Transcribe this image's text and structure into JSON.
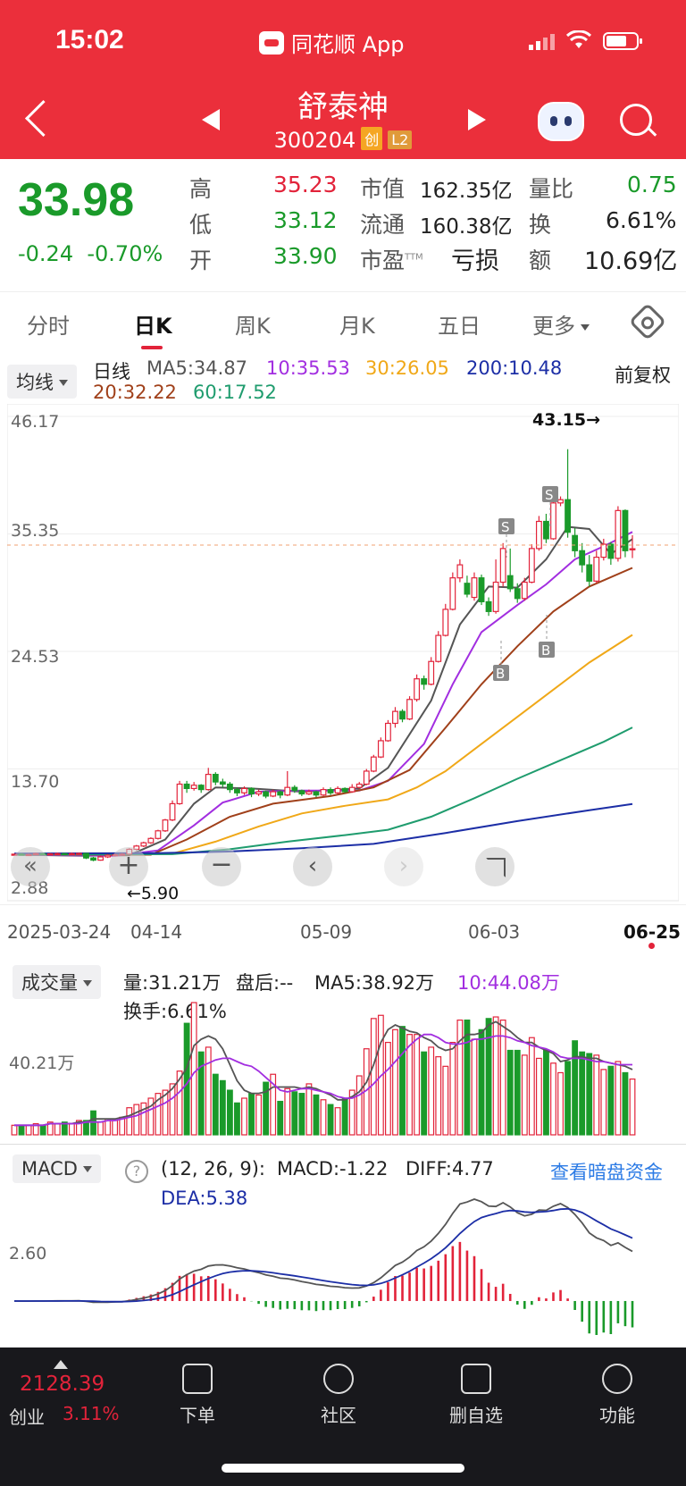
{
  "status_bar": {
    "time": "15:02",
    "app": "同花顺 App"
  },
  "header": {
    "title": "舒泰神",
    "code": "300204",
    "tag1": "创",
    "tag2": "L2"
  },
  "quote": {
    "price": "33.98",
    "change": "-0.24",
    "change_pct": "-0.70%",
    "high_label": "高",
    "high": "35.23",
    "low_label": "低",
    "low": "33.12",
    "open_label": "开",
    "open": "33.90",
    "mcap_label": "市值",
    "mcap": "162.35亿",
    "float_label": "流通",
    "float": "160.38亿",
    "pe_label": "市盈",
    "pe_sup": "TTM",
    "pe": "亏损",
    "vol_ratio_label": "量比",
    "vol_ratio": "0.75",
    "turnover_label": "换",
    "turnover": "6.61%",
    "amount_label": "额",
    "amount": "10.69亿"
  },
  "tabs": [
    "分时",
    "日K",
    "周K",
    "月K",
    "五日",
    "更多"
  ],
  "ma": {
    "selector": "均线",
    "period": "日线",
    "ma5": "MA5:34.87",
    "ma10": "10:35.53",
    "ma30": "30:26.05",
    "ma200": "200:10.48",
    "ma20": "20:32.22",
    "ma60": "60:17.52",
    "adjust": "前复权"
  },
  "kchart": {
    "y_labels": [
      "46.17",
      "35.35",
      "24.53",
      "13.70",
      "2.88"
    ],
    "max_label": "43.15→",
    "min_label": "←5.90",
    "x_labels": [
      "2025-03-24",
      "04-14",
      "05-09",
      "06-03",
      "06-25"
    ]
  },
  "volume": {
    "selector": "成交量",
    "vol": "量:31.21万",
    "after": "盘后:--",
    "ma5": "MA5:38.92万",
    "ma10": "10:44.08万",
    "turnover": "换手:6.61%",
    "y_label": "40.21万"
  },
  "macd": {
    "selector": "MACD",
    "params": "(12, 26, 9):",
    "macd": "MACD:-1.22",
    "diff": "DIFF:4.77",
    "dea": "DEA:5.38",
    "link": "查看暗盘资金",
    "y_label": "2.60"
  },
  "bottom": {
    "index_value": "2128.39",
    "index_name": "创业",
    "index_pct": "3.11%",
    "nav": [
      "下单",
      "社区",
      "删自选",
      "功能"
    ]
  },
  "colors": {
    "up": "#e2233a",
    "down": "#1a9a2a",
    "brand": "#eb2f3b"
  },
  "chart_data": {
    "type": "candlestick",
    "x_start": "2025-03-24",
    "x_end": "2025-06-25",
    "ylim": [
      2.88,
      46.17
    ],
    "candles": [
      [
        5.8,
        5.85,
        5.9,
        5.75
      ],
      [
        5.85,
        5.8,
        5.95,
        5.75
      ],
      [
        5.8,
        5.82,
        5.9,
        5.7
      ],
      [
        5.82,
        5.9,
        6.0,
        5.78
      ],
      [
        5.9,
        5.85,
        5.98,
        5.8
      ],
      [
        5.85,
        5.88,
        5.95,
        5.8
      ],
      [
        5.88,
        5.9,
        6.0,
        5.82
      ],
      [
        5.9,
        5.87,
        5.96,
        5.8
      ],
      [
        5.87,
        5.9,
        6.0,
        5.85
      ],
      [
        5.9,
        5.92,
        6.0,
        5.85
      ],
      [
        5.92,
        5.5,
        5.95,
        5.4
      ],
      [
        5.5,
        5.3,
        5.6,
        5.2
      ],
      [
        5.3,
        5.6,
        5.7,
        5.25
      ],
      [
        5.6,
        5.75,
        5.85,
        5.5
      ],
      [
        5.75,
        5.8,
        5.9,
        5.7
      ],
      [
        5.8,
        5.85,
        5.95,
        5.75
      ],
      [
        5.85,
        6.3,
        6.4,
        5.8
      ],
      [
        6.3,
        6.6,
        6.7,
        6.2
      ],
      [
        6.6,
        6.9,
        7.0,
        6.5
      ],
      [
        6.9,
        7.3,
        7.4,
        6.8
      ],
      [
        7.3,
        8.0,
        8.1,
        7.2
      ],
      [
        8.0,
        9.0,
        9.1,
        7.9
      ],
      [
        9.0,
        10.5,
        10.8,
        8.9
      ],
      [
        10.5,
        12.3,
        12.6,
        10.4
      ],
      [
        12.3,
        11.9,
        12.6,
        11.5
      ],
      [
        11.9,
        12.2,
        12.5,
        11.7
      ],
      [
        12.2,
        11.8,
        12.3,
        11.5
      ],
      [
        11.8,
        13.2,
        13.8,
        11.7
      ],
      [
        13.2,
        12.5,
        13.4,
        12.2
      ],
      [
        12.5,
        12.3,
        12.8,
        12.0
      ],
      [
        12.3,
        11.8,
        12.5,
        11.5
      ],
      [
        11.8,
        11.5,
        12.0,
        11.2
      ],
      [
        11.5,
        11.9,
        12.1,
        11.3
      ],
      [
        11.9,
        11.4,
        12.0,
        11.1
      ],
      [
        11.4,
        11.6,
        11.8,
        11.2
      ],
      [
        11.6,
        11.2,
        11.7,
        11.0
      ],
      [
        11.2,
        11.6,
        11.8,
        11.1
      ],
      [
        11.6,
        11.3,
        11.7,
        11.0
      ],
      [
        11.3,
        12.0,
        13.5,
        11.2
      ],
      [
        12.0,
        11.7,
        12.2,
        11.5
      ],
      [
        11.7,
        11.4,
        11.8,
        11.2
      ],
      [
        11.4,
        11.6,
        11.8,
        11.3
      ],
      [
        11.6,
        11.3,
        11.7,
        11.1
      ],
      [
        11.3,
        11.8,
        12.0,
        11.2
      ],
      [
        11.8,
        11.5,
        12.0,
        11.3
      ],
      [
        11.5,
        11.9,
        12.1,
        11.4
      ],
      [
        11.9,
        11.6,
        12.0,
        11.5
      ],
      [
        11.6,
        12.0,
        12.3,
        11.5
      ],
      [
        12.0,
        12.3,
        12.5,
        11.9
      ],
      [
        12.3,
        13.5,
        13.7,
        12.2
      ],
      [
        13.5,
        14.8,
        15.0,
        13.4
      ],
      [
        14.8,
        16.3,
        16.6,
        14.7
      ],
      [
        16.3,
        17.9,
        18.2,
        16.2
      ],
      [
        17.9,
        19.0,
        19.4,
        17.5
      ],
      [
        19.0,
        18.3,
        19.2,
        18.0
      ],
      [
        18.3,
        20.1,
        20.4,
        18.2
      ],
      [
        20.1,
        22.0,
        22.4,
        19.9
      ],
      [
        22.0,
        21.5,
        22.3,
        21.0
      ],
      [
        21.5,
        23.6,
        24.0,
        21.4
      ],
      [
        23.6,
        26.0,
        26.4,
        23.5
      ],
      [
        26.0,
        28.4,
        28.9,
        25.9
      ],
      [
        28.4,
        31.3,
        31.8,
        28.3
      ],
      [
        31.3,
        32.5,
        33.0,
        30.9
      ],
      [
        30.8,
        29.8,
        31.5,
        29.5
      ],
      [
        29.5,
        31.3,
        31.8,
        29.2
      ],
      [
        31.3,
        29.1,
        31.6,
        28.8
      ],
      [
        29.1,
        28.2,
        29.5,
        27.8
      ],
      [
        28.2,
        30.9,
        33.0,
        28.0
      ],
      [
        30.9,
        34.0,
        34.5,
        30.5
      ],
      [
        31.5,
        30.3,
        34.0,
        30.0
      ],
      [
        30.3,
        29.4,
        30.8,
        29.0
      ],
      [
        29.4,
        30.9,
        31.3,
        29.2
      ],
      [
        30.9,
        34.0,
        34.4,
        30.8
      ],
      [
        34.0,
        36.5,
        37.0,
        33.8
      ],
      [
        36.5,
        34.9,
        37.2,
        34.5
      ],
      [
        34.9,
        38.2,
        38.5,
        34.8
      ],
      [
        38.2,
        38.5,
        38.8,
        37.9
      ],
      [
        38.5,
        35.5,
        43.15,
        35.0
      ],
      [
        35.2,
        33.8,
        35.9,
        33.2
      ],
      [
        33.8,
        32.5,
        34.5,
        31.8
      ],
      [
        32.5,
        31.0,
        33.4,
        30.5
      ],
      [
        31.0,
        33.2,
        33.8,
        30.8
      ],
      [
        33.2,
        34.4,
        34.9,
        32.9
      ],
      [
        34.4,
        33.1,
        34.6,
        32.5
      ],
      [
        33.1,
        37.5,
        37.9,
        32.8
      ],
      [
        37.5,
        33.8,
        37.6,
        33.2
      ],
      [
        33.9,
        33.98,
        35.23,
        33.12
      ]
    ],
    "ma_series": [
      {
        "name": "MA5",
        "color": "#555555",
        "values": [
          [
            0,
            5.8
          ],
          [
            10,
            5.7
          ],
          [
            16,
            5.75
          ],
          [
            21,
            7.2
          ],
          [
            25,
            10.5
          ],
          [
            28,
            12.0
          ],
          [
            33,
            11.9
          ],
          [
            40,
            11.6
          ],
          [
            48,
            11.9
          ],
          [
            52,
            13.8
          ],
          [
            58,
            20.0
          ],
          [
            62,
            27.0
          ],
          [
            66,
            30.5
          ],
          [
            70,
            30.4
          ],
          [
            74,
            33.0
          ],
          [
            77,
            36.0
          ],
          [
            80,
            35.8
          ],
          [
            83,
            33.5
          ],
          [
            86,
            34.87
          ]
        ]
      },
      {
        "name": "MA10",
        "color": "#a22ee0",
        "values": [
          [
            0,
            5.8
          ],
          [
            14,
            5.7
          ],
          [
            20,
            6.2
          ],
          [
            25,
            8.5
          ],
          [
            29,
            10.6
          ],
          [
            34,
            11.6
          ],
          [
            40,
            11.7
          ],
          [
            48,
            11.7
          ],
          [
            52,
            12.6
          ],
          [
            57,
            16.0
          ],
          [
            61,
            21.5
          ],
          [
            65,
            26.3
          ],
          [
            70,
            28.8
          ],
          [
            74,
            30.7
          ],
          [
            78,
            33.0
          ],
          [
            82,
            34.2
          ],
          [
            86,
            35.53
          ]
        ]
      },
      {
        "name": "MA20",
        "color": "#a0401a",
        "values": [
          [
            0,
            5.8
          ],
          [
            19,
            5.8
          ],
          [
            24,
            7.2
          ],
          [
            30,
            9.3
          ],
          [
            36,
            10.5
          ],
          [
            44,
            11.2
          ],
          [
            50,
            12.0
          ],
          [
            55,
            13.6
          ],
          [
            60,
            17.5
          ],
          [
            65,
            21.5
          ],
          [
            70,
            25.0
          ],
          [
            75,
            28.2
          ],
          [
            80,
            30.5
          ],
          [
            86,
            32.22
          ]
        ]
      },
      {
        "name": "MA30",
        "color": "#f0a818",
        "values": [
          [
            0,
            5.8
          ],
          [
            22,
            5.9
          ],
          [
            28,
            7.0
          ],
          [
            34,
            8.4
          ],
          [
            40,
            9.6
          ],
          [
            46,
            10.3
          ],
          [
            52,
            10.9
          ],
          [
            56,
            12.0
          ],
          [
            60,
            13.5
          ],
          [
            65,
            16.0
          ],
          [
            70,
            18.5
          ],
          [
            75,
            21.0
          ],
          [
            80,
            23.5
          ],
          [
            86,
            26.05
          ]
        ]
      },
      {
        "name": "MA60",
        "color": "#1f9c6e",
        "values": [
          [
            0,
            5.8
          ],
          [
            22,
            5.85
          ],
          [
            30,
            6.3
          ],
          [
            38,
            7.0
          ],
          [
            46,
            7.6
          ],
          [
            52,
            8.1
          ],
          [
            58,
            9.3
          ],
          [
            64,
            11.0
          ],
          [
            70,
            12.8
          ],
          [
            76,
            14.5
          ],
          [
            82,
            16.2
          ],
          [
            86,
            17.52
          ]
        ]
      },
      {
        "name": "MA200",
        "color": "#1c2ea6",
        "values": [
          [
            0,
            5.9
          ],
          [
            20,
            5.95
          ],
          [
            30,
            6.1
          ],
          [
            40,
            6.4
          ],
          [
            50,
            6.8
          ],
          [
            60,
            7.8
          ],
          [
            70,
            8.9
          ],
          [
            80,
            9.9
          ],
          [
            86,
            10.48
          ]
        ]
      }
    ],
    "volume_ylabel_value": 40.21,
    "volume_max": 83,
    "volumes": [
      6,
      6,
      6,
      7,
      6,
      8,
      7,
      8,
      7,
      9,
      9,
      15,
      8,
      10,
      9,
      11,
      17,
      19,
      20,
      23,
      26,
      28,
      32,
      40,
      70,
      83,
      52,
      55,
      38,
      34,
      28,
      20,
      23,
      26,
      25,
      33,
      38,
      21,
      29,
      27,
      26,
      32,
      25,
      22,
      19,
      17,
      23,
      28,
      37,
      54,
      73,
      75,
      58,
      66,
      68,
      63,
      63,
      52,
      55,
      49,
      43,
      58,
      72,
      72,
      60,
      66,
      73,
      74,
      72,
      53,
      53,
      50,
      61,
      48,
      53,
      45,
      39,
      46,
      59,
      52,
      51,
      50,
      41,
      43,
      46,
      39,
      35
    ],
    "volume_ma5": [
      6,
      6,
      6,
      6,
      6,
      7,
      7,
      7,
      7,
      8,
      8,
      10,
      10,
      10,
      10,
      11,
      12,
      14,
      16,
      18,
      22,
      25,
      29,
      35,
      42,
      56,
      60,
      62,
      60,
      54,
      44,
      34,
      28,
      26,
      26,
      27,
      30,
      30,
      30,
      30,
      29,
      30,
      29,
      27,
      25,
      22,
      22,
      24,
      27,
      33,
      44,
      58,
      66,
      69,
      67,
      65,
      64,
      61,
      59,
      55,
      53,
      54,
      59,
      63,
      63,
      64,
      69,
      71,
      68,
      65,
      61,
      58,
      58,
      55,
      53,
      51,
      46,
      47,
      49,
      49,
      48,
      48,
      46,
      45,
      44,
      43,
      41
    ],
    "volume_ma10": [
      6,
      6,
      6,
      6,
      6,
      7,
      7,
      7,
      7,
      7,
      8,
      8,
      8,
      9,
      9,
      10,
      11,
      12,
      14,
      16,
      18,
      20,
      23,
      27,
      32,
      39,
      43,
      45,
      47,
      48,
      48,
      46,
      44,
      43,
      40,
      36,
      32,
      28,
      27,
      28,
      29,
      29,
      28,
      27,
      26,
      24,
      23,
      23,
      25,
      28,
      32,
      37,
      41,
      46,
      51,
      56,
      60,
      63,
      63,
      61,
      58,
      57,
      57,
      58,
      60,
      60,
      61,
      62,
      62,
      61,
      59,
      58,
      56,
      55,
      54,
      52,
      49,
      48,
      48,
      48,
      47,
      46,
      46,
      45,
      44,
      44,
      44
    ]
  }
}
